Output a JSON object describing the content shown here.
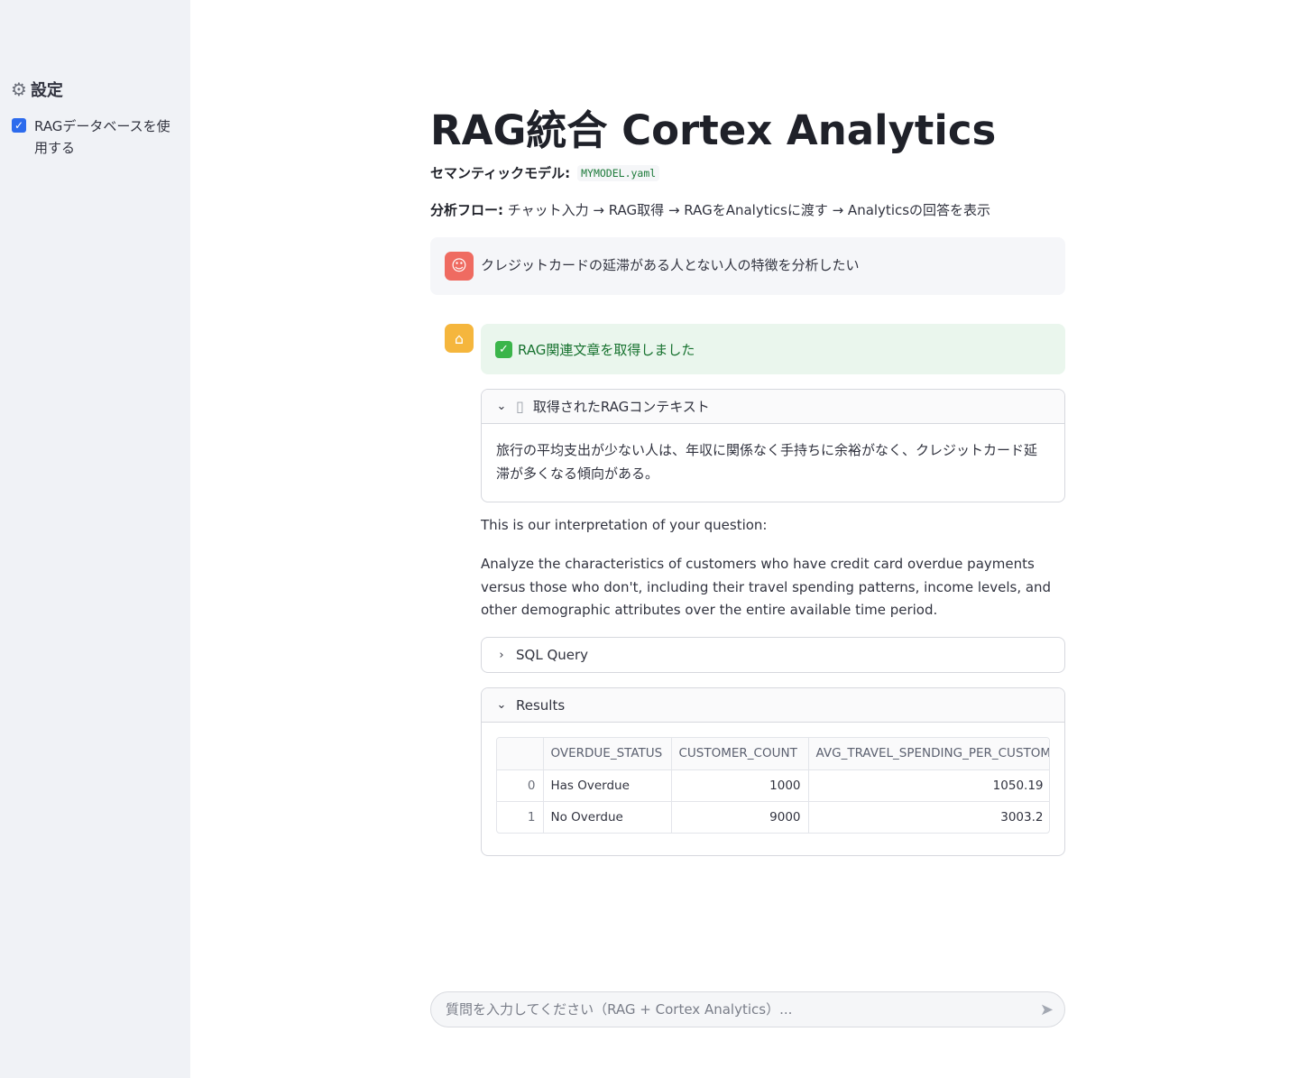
{
  "sidebar": {
    "title": "設定",
    "rag_checkbox": {
      "label": "RAGデータベースを使用する",
      "checked": true
    }
  },
  "main": {
    "title": "RAG統合 Cortex Analytics",
    "semantic_model_label": "セマンティックモデル:",
    "semantic_model_value": "MYMODEL.yaml",
    "flow_label": "分析フロー:",
    "flow_value": "チャット入力 → RAG取得 → RAGをAnalyticsに渡す → Analyticsの回答を表示"
  },
  "user_message": {
    "text": "クレジットカードの延滞がある人とない人の特徴を分析したい"
  },
  "assistant_message": {
    "success_text": "RAG関連文章を取得しました",
    "rag_context": {
      "title": "取得されたRAGコンテキスト",
      "body": "旅行の平均支出が少ない人は、年収に関係なく手持ちに余裕がなく、クレジットカード延滞が多くなる傾向がある。"
    },
    "interpretation_heading": "This is our interpretation of your question:",
    "interpretation_text": "Analyze the characteristics of customers who have credit card overdue payments versus those who don't, including their travel spending patterns, income levels, and other demographic attributes over the entire available time period.",
    "sql_expander": {
      "title": "SQL Query"
    },
    "results_expander": {
      "title": "Results",
      "columns": [
        "",
        "OVERDUE_STATUS",
        "CUSTOMER_COUNT",
        "AVG_TRAVEL_SPENDING_PER_CUSTOM"
      ],
      "rows": [
        [
          "0",
          "Has Overdue",
          "1000",
          "1050.19"
        ],
        [
          "1",
          "No Overdue",
          "9000",
          "3003.2"
        ]
      ]
    }
  },
  "chat_input": {
    "placeholder": "質問を入力してください（RAG + Cortex Analytics）..."
  },
  "colors": {
    "sidebar_bg": "#f0f2f6",
    "user_avatar": "#ef6b61",
    "bot_avatar": "#f5b63d",
    "success_bg": "#eaf6ed",
    "success_text": "#17722f",
    "checkbox": "#2c6bed"
  }
}
